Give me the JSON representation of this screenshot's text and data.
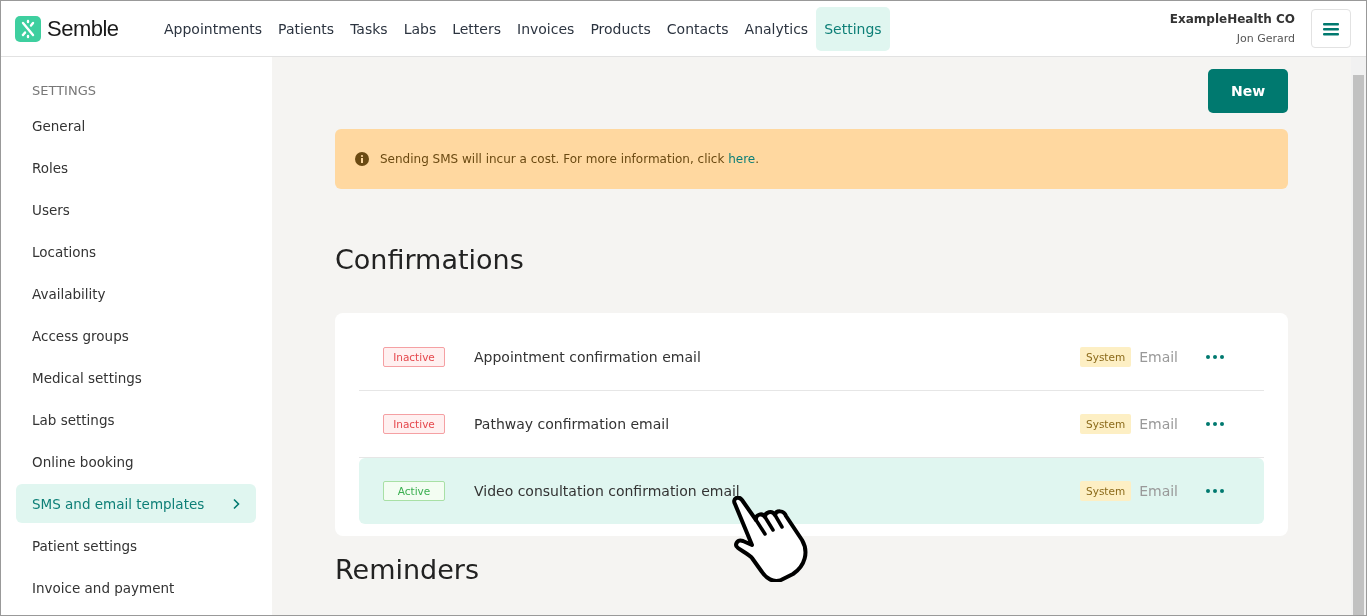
{
  "header": {
    "logo": "Semble",
    "nav": [
      {
        "label": "Appointments",
        "selected": false
      },
      {
        "label": "Patients",
        "selected": false
      },
      {
        "label": "Tasks",
        "selected": false
      },
      {
        "label": "Labs",
        "selected": false
      },
      {
        "label": "Letters",
        "selected": false
      },
      {
        "label": "Invoices",
        "selected": false
      },
      {
        "label": "Products",
        "selected": false
      },
      {
        "label": "Contacts",
        "selected": false
      },
      {
        "label": "Analytics",
        "selected": false
      },
      {
        "label": "Settings",
        "selected": true
      }
    ],
    "organization": "ExampleHealth CO",
    "user": "Jon Gerard"
  },
  "sidebar": {
    "heading": "SETTINGS",
    "items": [
      {
        "label": "General",
        "selected": false
      },
      {
        "label": "Roles",
        "selected": false
      },
      {
        "label": "Users",
        "selected": false
      },
      {
        "label": "Locations",
        "selected": false
      },
      {
        "label": "Availability",
        "selected": false
      },
      {
        "label": "Access groups",
        "selected": false
      },
      {
        "label": "Medical settings",
        "selected": false
      },
      {
        "label": "Lab settings",
        "selected": false
      },
      {
        "label": "Online booking",
        "selected": false
      },
      {
        "label": "SMS and email templates",
        "selected": true
      },
      {
        "label": "Patient settings",
        "selected": false
      },
      {
        "label": "Invoice and payment",
        "selected": false
      }
    ]
  },
  "new_button": "New",
  "alert": {
    "text": "Sending SMS will incur a cost. For more information, click ",
    "link": "here",
    "after": "."
  },
  "sections": [
    {
      "title": "Confirmations",
      "templates": [
        {
          "status": "Inactive",
          "kind": "inactive",
          "name": "Appointment confirmation email",
          "tag": "System",
          "channel": "Email",
          "highlighted": false
        },
        {
          "status": "Inactive",
          "kind": "inactive",
          "name": "Pathway confirmation email",
          "tag": "System",
          "channel": "Email",
          "highlighted": false
        },
        {
          "status": "Active",
          "kind": "active",
          "name": "Video consultation confirmation email",
          "tag": "System",
          "channel": "Email",
          "highlighted": true
        }
      ]
    },
    {
      "title": "Reminders"
    }
  ]
}
